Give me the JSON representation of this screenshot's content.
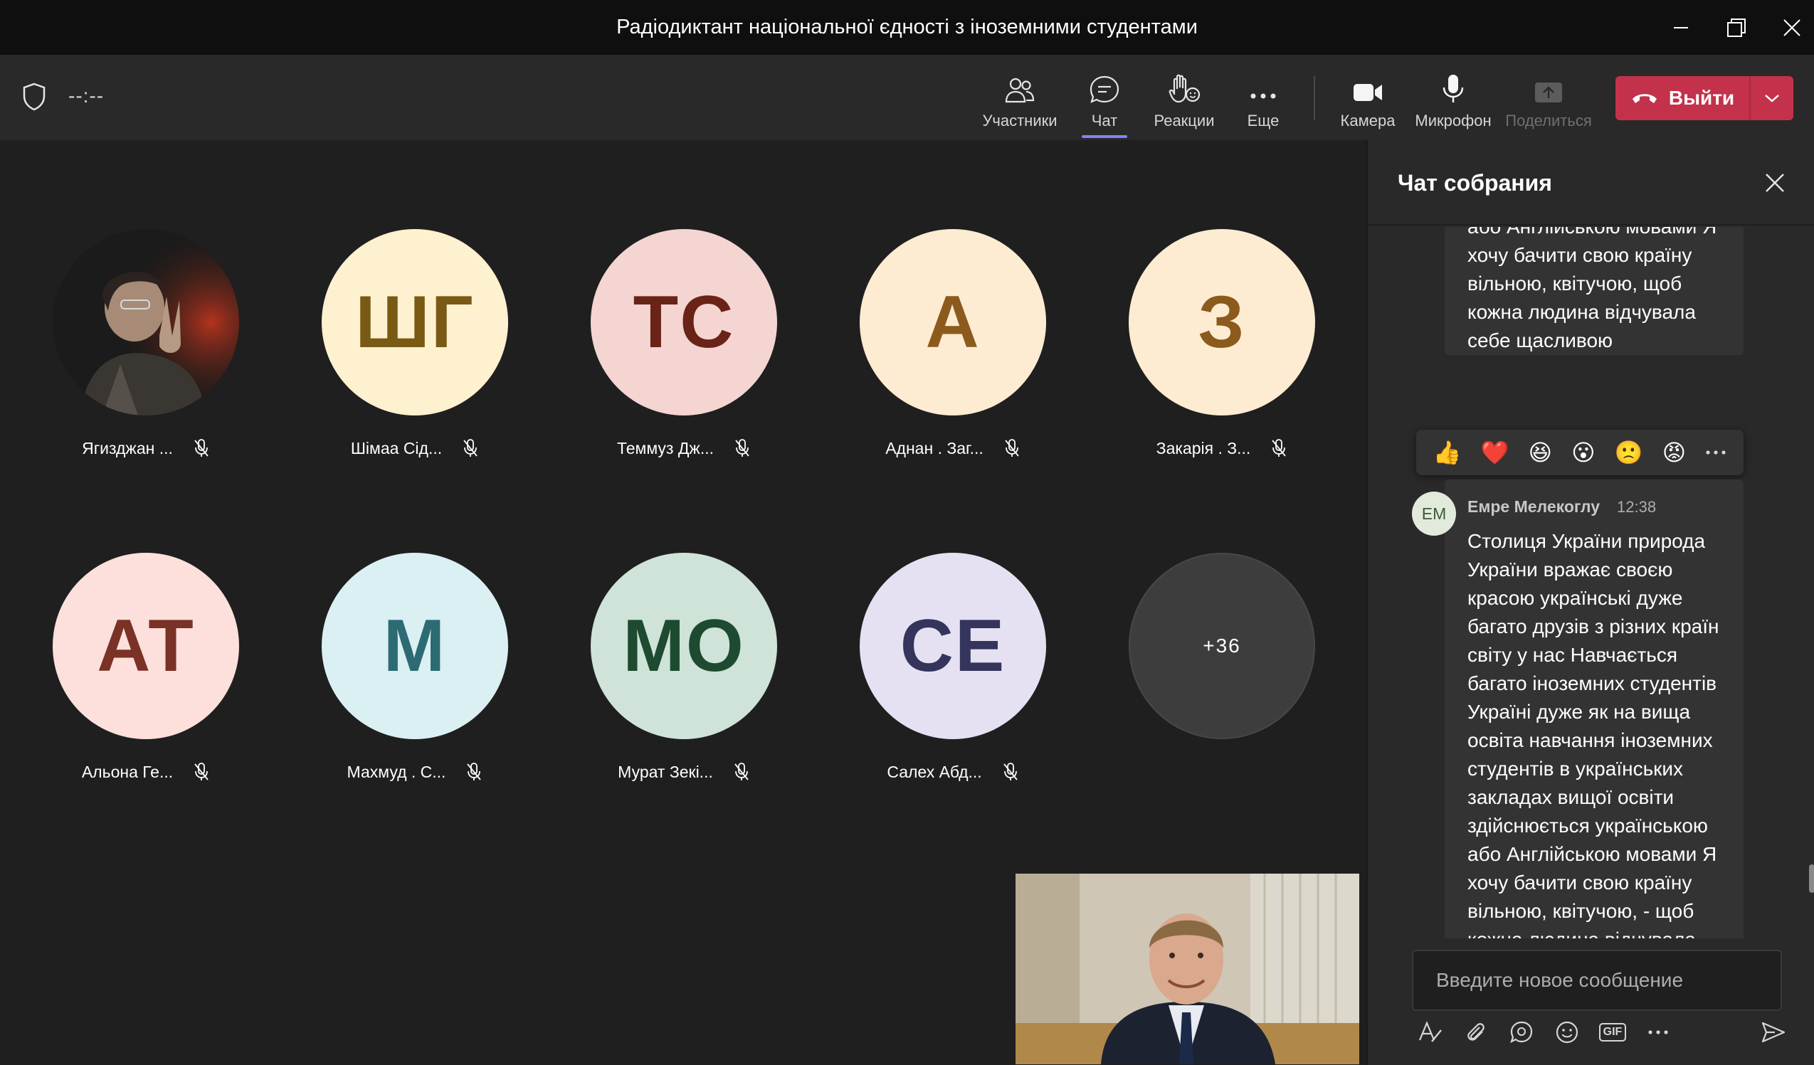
{
  "window": {
    "title": "Радіодиктант національної єдності з іноземними студентами"
  },
  "toolbar": {
    "timer": "--:--",
    "items": [
      {
        "label": "Участники"
      },
      {
        "label": "Чат"
      },
      {
        "label": "Реакции"
      },
      {
        "label": "Еще"
      },
      {
        "label": "Камера"
      },
      {
        "label": "Микрофон"
      },
      {
        "label": "Поделиться"
      }
    ],
    "leave_label": "Выйти",
    "colors": {
      "leave": "#c4314b",
      "accent": "#7f85f5"
    }
  },
  "participants": [
    {
      "name": "Ягизджан ...",
      "initials": "",
      "bg": "#000000",
      "fg": "#ffffff"
    },
    {
      "name": "Шімаа Сід...",
      "initials": "ШГ",
      "bg": "#fdf1cf",
      "fg": "#795a14"
    },
    {
      "name": "Теммуз Дж...",
      "initials": "ТС",
      "bg": "#f4d5d2",
      "fg": "#6a2317"
    },
    {
      "name": "Аднан . Заг...",
      "initials": "А",
      "bg": "#fdecd2",
      "fg": "#8b5a1c"
    },
    {
      "name": "Закарія . З...",
      "initials": "З",
      "bg": "#fdecd2",
      "fg": "#8b5a1c"
    },
    {
      "name": "Альона Ге...",
      "initials": "АТ",
      "bg": "#fde0dc",
      "fg": "#7a3226"
    },
    {
      "name": "Махмуд . С...",
      "initials": "М",
      "bg": "#dbf0f3",
      "fg": "#2c6b73"
    },
    {
      "name": "Мурат Зекі...",
      "initials": "МО",
      "bg": "#cfe3d8",
      "fg": "#1d4a31"
    },
    {
      "name": "Салех Абд...",
      "initials": "СЕ",
      "bg": "#e5e1f2",
      "fg": "#34345c"
    }
  ],
  "overflow_count": "+36",
  "chat": {
    "title": "Чат собрания",
    "prev_message_tail": "або Англійською мовами Я хочу бачити свою країну вільною, квітучою, щоб кожна людина відчувала себе щасливою",
    "reactions": [
      "👍",
      "❤️",
      "😆",
      "😮",
      "🙁",
      "😡"
    ],
    "message": {
      "author": "Емре Мелекоглу",
      "initials": "ЕМ",
      "time": "12:38",
      "text": "Столиця України природа України вражає своєю красою українські дуже багато друзів з різних країн світу у нас Навчається багато іноземних студентів Україні дуже як на вища освіта навчання іноземних студентів в українських закладах вищої освіти здійснюється українською або Англійською мовами Я хочу бачити свою країну вільною, квітучою, - щоб кожна людина відчувала себе щасливою."
    },
    "compose_placeholder": "Введите новое сообщение"
  }
}
